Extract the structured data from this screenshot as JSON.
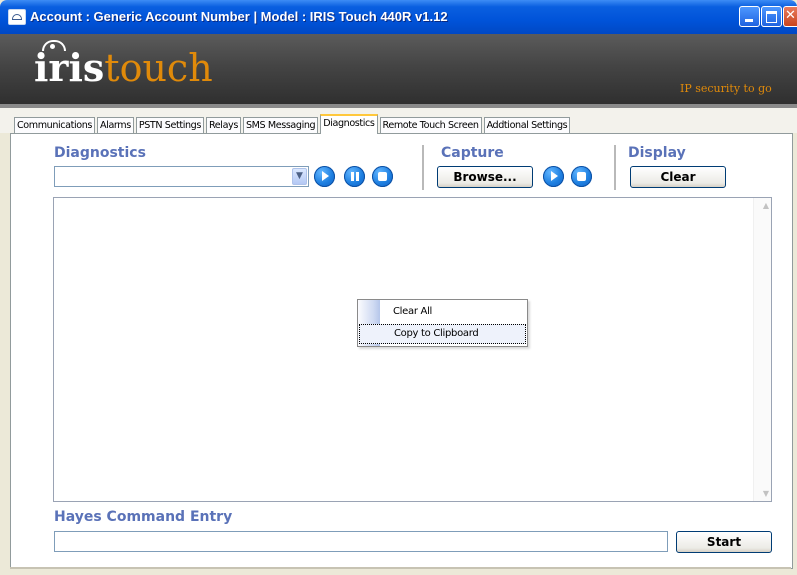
{
  "window": {
    "title": "Account : Generic Account Number | Model : IRIS Touch 440R v1.12"
  },
  "banner": {
    "logo_part1": "iris",
    "logo_part2": "touch",
    "tagline": "IP security to go"
  },
  "tabs": [
    {
      "label": "Communications",
      "active": false
    },
    {
      "label": "Alarms",
      "active": false
    },
    {
      "label": "PSTN Settings",
      "active": false
    },
    {
      "label": "Relays",
      "active": false
    },
    {
      "label": "SMS Messaging",
      "active": false
    },
    {
      "label": "Diagnostics",
      "active": true
    },
    {
      "label": "Remote Touch Screen",
      "active": false
    },
    {
      "label": "Addtional Settings",
      "active": false
    }
  ],
  "diagnostics": {
    "heading": "Diagnostics",
    "selected_value": ""
  },
  "capture": {
    "heading": "Capture",
    "browse_label": "Browse..."
  },
  "display": {
    "heading": "Display",
    "clear_label": "Clear"
  },
  "context_menu": {
    "items": [
      "Clear All",
      "Copy to Clipboard"
    ]
  },
  "hayes": {
    "heading": "Hayes Command Entry",
    "value": "",
    "start_label": "Start"
  },
  "colors": {
    "section_heading": "#5a72b8",
    "logo_orange": "#e08a0a",
    "titlebar_blue": "#0053d9"
  }
}
